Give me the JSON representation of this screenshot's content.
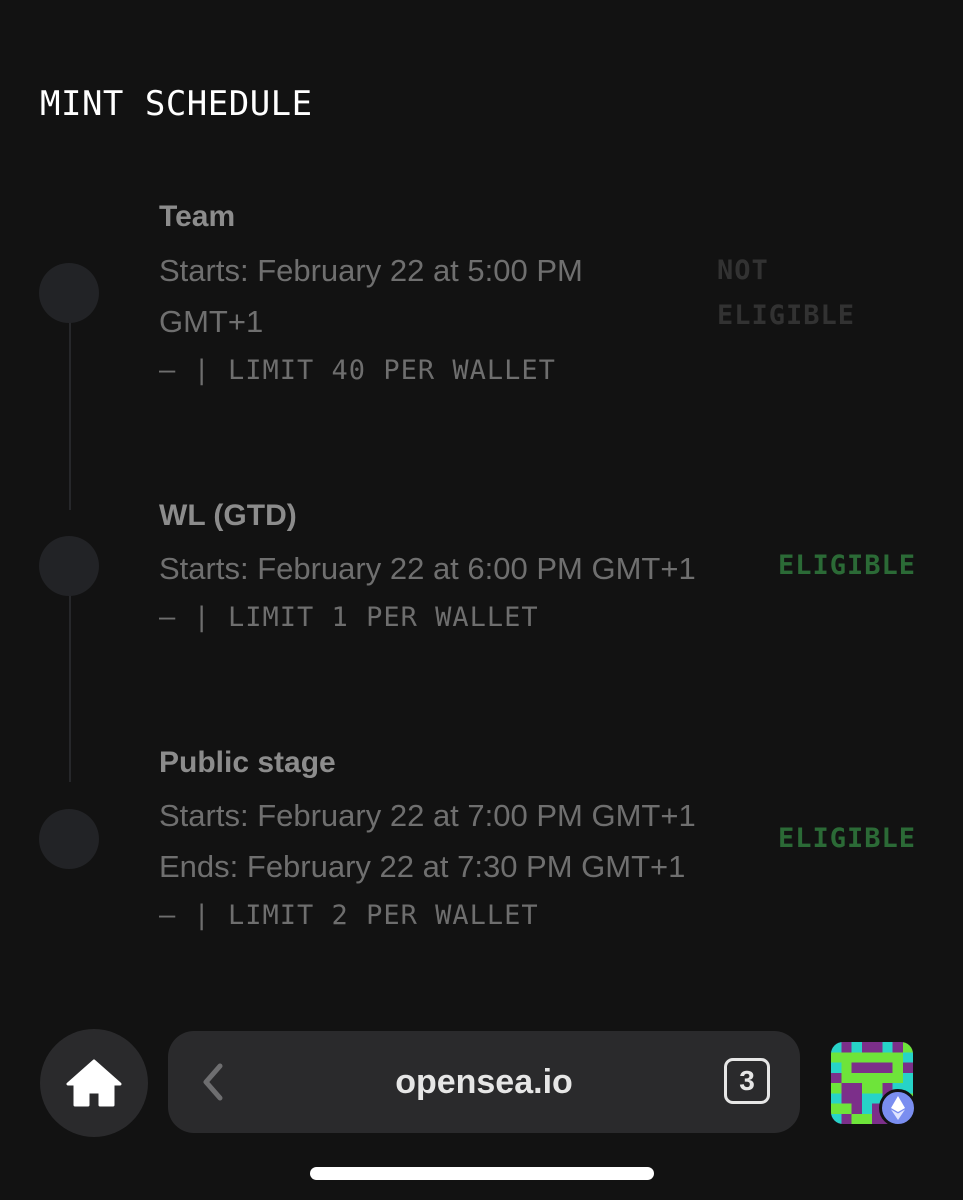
{
  "mint_schedule": {
    "title": "MINT SCHEDULE",
    "stages": [
      {
        "name": "Team",
        "start_line_1": "Starts: February 22 at 5:00 PM",
        "start_line_2": "GMT+1",
        "limit": "— | LIMIT 40 PER WALLET",
        "status": "NOT ELIGIBLE"
      },
      {
        "name": "WL (GTD)",
        "start_line_1": "Starts: February 22 at 6:00 PM GMT+1",
        "limit": "— | LIMIT 1 PER WALLET",
        "status": "ELIGIBLE"
      },
      {
        "name": "Public stage",
        "start_line_1": "Starts: February 22 at 7:00 PM GMT+1",
        "end_line": "Ends: February 22 at 7:30 PM GMT+1",
        "limit": "— | LIMIT 2 PER WALLET",
        "status": "ELIGIBLE"
      }
    ]
  },
  "browser_bar": {
    "home_icon": "home-icon",
    "back_icon": "chevron-left-icon",
    "url": "opensea.io",
    "tab_count": "3",
    "avatar_icon": "pixel-avatar-icon",
    "network_icon": "ethereum-icon"
  },
  "colors": {
    "background": "#121212",
    "eligible": "#2b6a36",
    "not_eligible": "#323232",
    "bar": "#2a2a2c"
  }
}
